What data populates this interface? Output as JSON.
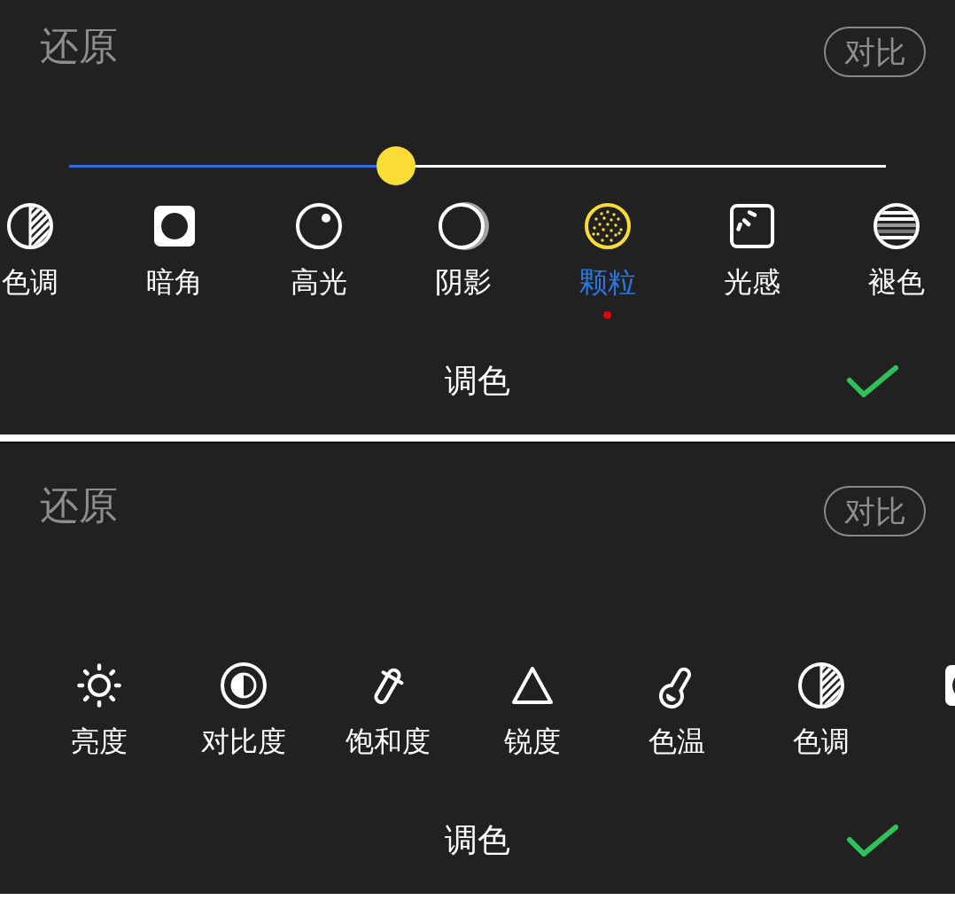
{
  "panels": [
    {
      "reset": "还原",
      "compare": "对比",
      "slider": {
        "level": 0.4
      },
      "tools": [
        {
          "kind": "tone",
          "label": "色调",
          "selected": false,
          "badge": false
        },
        {
          "kind": "vignette",
          "label": "暗角",
          "selected": false,
          "badge": false
        },
        {
          "kind": "highlight",
          "label": "高光",
          "selected": false,
          "badge": false
        },
        {
          "kind": "shadow",
          "label": "阴影",
          "selected": false,
          "badge": false
        },
        {
          "kind": "grain",
          "label": "颗粒",
          "selected": true,
          "badge": true
        },
        {
          "kind": "light",
          "label": "光感",
          "selected": false,
          "badge": false
        },
        {
          "kind": "fade",
          "label": "褪色",
          "selected": false,
          "badge": false
        }
      ],
      "title": "调色"
    },
    {
      "reset": "还原",
      "compare": "对比",
      "tools": [
        {
          "kind": "brightness",
          "label": "亮度",
          "selected": false,
          "badge": false
        },
        {
          "kind": "contrast",
          "label": "对比度",
          "selected": false,
          "badge": false
        },
        {
          "kind": "saturation",
          "label": "饱和度",
          "selected": false,
          "badge": false
        },
        {
          "kind": "sharpness",
          "label": "锐度",
          "selected": false,
          "badge": false
        },
        {
          "kind": "temperature",
          "label": "色温",
          "selected": false,
          "badge": false
        },
        {
          "kind": "tone",
          "label": "色调",
          "selected": false,
          "badge": false
        },
        {
          "kind": "vignette",
          "selected": false,
          "badge": false
        }
      ],
      "title": "调色"
    }
  ]
}
